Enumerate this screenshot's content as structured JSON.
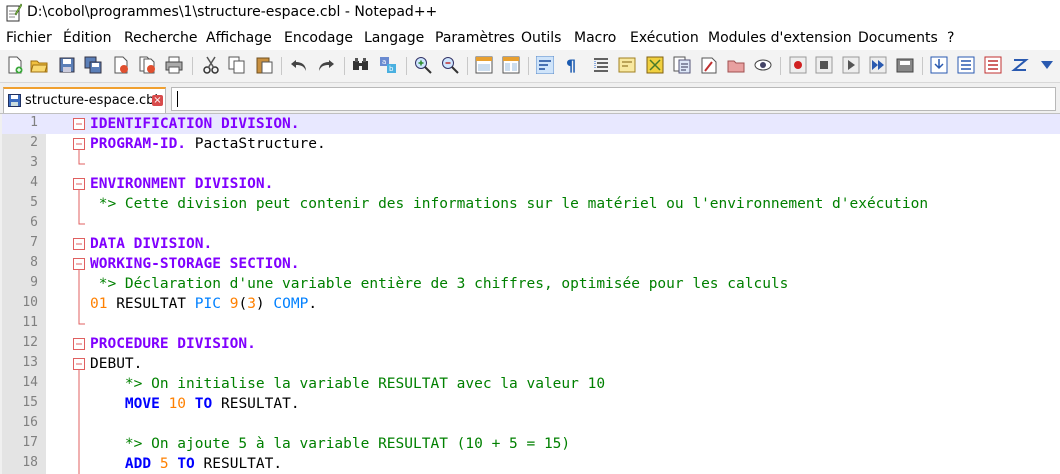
{
  "window": {
    "title": "D:\\cobol\\programmes\\1\\structure-espace.cbl - Notepad++"
  },
  "menu": [
    "Fichier",
    "Édition",
    "Recherche",
    "Affichage",
    "Encodage",
    "Langage",
    "Paramètres",
    "Outils",
    "Macro",
    "Exécution",
    "Modules d'extension",
    "Documents",
    "?"
  ],
  "toolbar": {
    "icons": [
      "new-file-icon",
      "open-file-icon",
      "save-icon",
      "save-all-icon",
      "close-icon",
      "close-all-icon",
      "print-icon",
      "cut-icon",
      "copy-icon",
      "paste-icon",
      "undo-icon",
      "redo-icon",
      "find-icon",
      "replace-icon",
      "zoom-in-icon",
      "zoom-out-icon",
      "sync-vertical-icon",
      "sync-horizontal-icon",
      "word-wrap-icon",
      "show-all-chars-icon",
      "indent-guide-icon",
      "user-language-icon",
      "doc-map-icon",
      "function-list-icon",
      "folder-workspace-icon",
      "doc-list-icon",
      "monitoring-icon",
      "record-macro-icon",
      "stop-macro-icon",
      "play-macro-icon",
      "run-macro-multiple-icon",
      "save-macro-icon",
      "extra-1-icon",
      "extra-2-icon",
      "extra-3-icon",
      "extra-4-icon",
      "extra-5-icon"
    ]
  },
  "tab": {
    "label": "structure-espace.cbl",
    "close_symbol": "×"
  },
  "editor": {
    "lines": [
      {
        "n": "1",
        "tokens": [
          {
            "t": "IDENTIFICATION DIVISION.",
            "c": "kw-div"
          }
        ]
      },
      {
        "n": "2",
        "tokens": [
          {
            "t": "PROGRAM-ID.",
            "c": "kw-div"
          },
          {
            "t": " PactaStructure.",
            "c": "plain"
          }
        ]
      },
      {
        "n": "3",
        "tokens": []
      },
      {
        "n": "4",
        "tokens": [
          {
            "t": "ENVIRONMENT DIVISION.",
            "c": "kw-div"
          }
        ]
      },
      {
        "n": "5",
        "tokens": [
          {
            "t": " *> Cette division peut contenir des informations sur le matériel ou l'environnement d'exécution",
            "c": "cmt"
          }
        ]
      },
      {
        "n": "6",
        "tokens": []
      },
      {
        "n": "7",
        "tokens": [
          {
            "t": "DATA DIVISION.",
            "c": "kw-div"
          }
        ]
      },
      {
        "n": "8",
        "tokens": [
          {
            "t": "WORKING-STORAGE SECTION.",
            "c": "kw-div"
          }
        ]
      },
      {
        "n": "9",
        "tokens": [
          {
            "t": " *> Déclaration d'une variable entière de 3 chiffres, optimisée pour les calculs",
            "c": "cmt"
          }
        ]
      },
      {
        "n": "10",
        "tokens": [
          {
            "t": "01",
            "c": "num"
          },
          {
            "t": " RESULTAT ",
            "c": "plain"
          },
          {
            "t": "PIC",
            "c": "kw-type"
          },
          {
            "t": " ",
            "c": "plain"
          },
          {
            "t": "9",
            "c": "num"
          },
          {
            "t": "(",
            "c": "plain"
          },
          {
            "t": "3",
            "c": "num"
          },
          {
            "t": ") ",
            "c": "plain"
          },
          {
            "t": "COMP",
            "c": "kw-type"
          },
          {
            "t": ".",
            "c": "plain"
          }
        ]
      },
      {
        "n": "11",
        "tokens": []
      },
      {
        "n": "12",
        "tokens": [
          {
            "t": "PROCEDURE DIVISION.",
            "c": "kw-div"
          }
        ]
      },
      {
        "n": "13",
        "tokens": [
          {
            "t": "DEBUT.",
            "c": "plain"
          }
        ]
      },
      {
        "n": "14",
        "tokens": [
          {
            "t": "    *> On initialise la variable RESULTAT avec la valeur 10",
            "c": "cmt"
          }
        ]
      },
      {
        "n": "15",
        "tokens": [
          {
            "t": "    ",
            "c": "plain"
          },
          {
            "t": "MOVE",
            "c": "kw-verb"
          },
          {
            "t": " ",
            "c": "plain"
          },
          {
            "t": "10",
            "c": "num"
          },
          {
            "t": " ",
            "c": "plain"
          },
          {
            "t": "TO",
            "c": "kw-verb"
          },
          {
            "t": " RESULTAT.",
            "c": "plain"
          }
        ]
      },
      {
        "n": "16",
        "tokens": []
      },
      {
        "n": "17",
        "tokens": [
          {
            "t": "    *> On ajoute 5 à la variable RESULTAT (10 + 5 = 15)",
            "c": "cmt"
          }
        ]
      },
      {
        "n": "18",
        "tokens": [
          {
            "t": "    ",
            "c": "plain"
          },
          {
            "t": "ADD",
            "c": "kw-verb"
          },
          {
            "t": " ",
            "c": "plain"
          },
          {
            "t": "5",
            "c": "num"
          },
          {
            "t": " ",
            "c": "plain"
          },
          {
            "t": "TO",
            "c": "kw-verb"
          },
          {
            "t": " RESULTAT.",
            "c": "plain"
          }
        ]
      }
    ]
  },
  "colors": {
    "division_keyword": "#8000ff",
    "verb_keyword": "#0000ff",
    "type_keyword": "#0080ff",
    "number": "#ff8000",
    "comment": "#008000",
    "fold_marker": "#e06060",
    "current_line": "#e8e8ff"
  }
}
